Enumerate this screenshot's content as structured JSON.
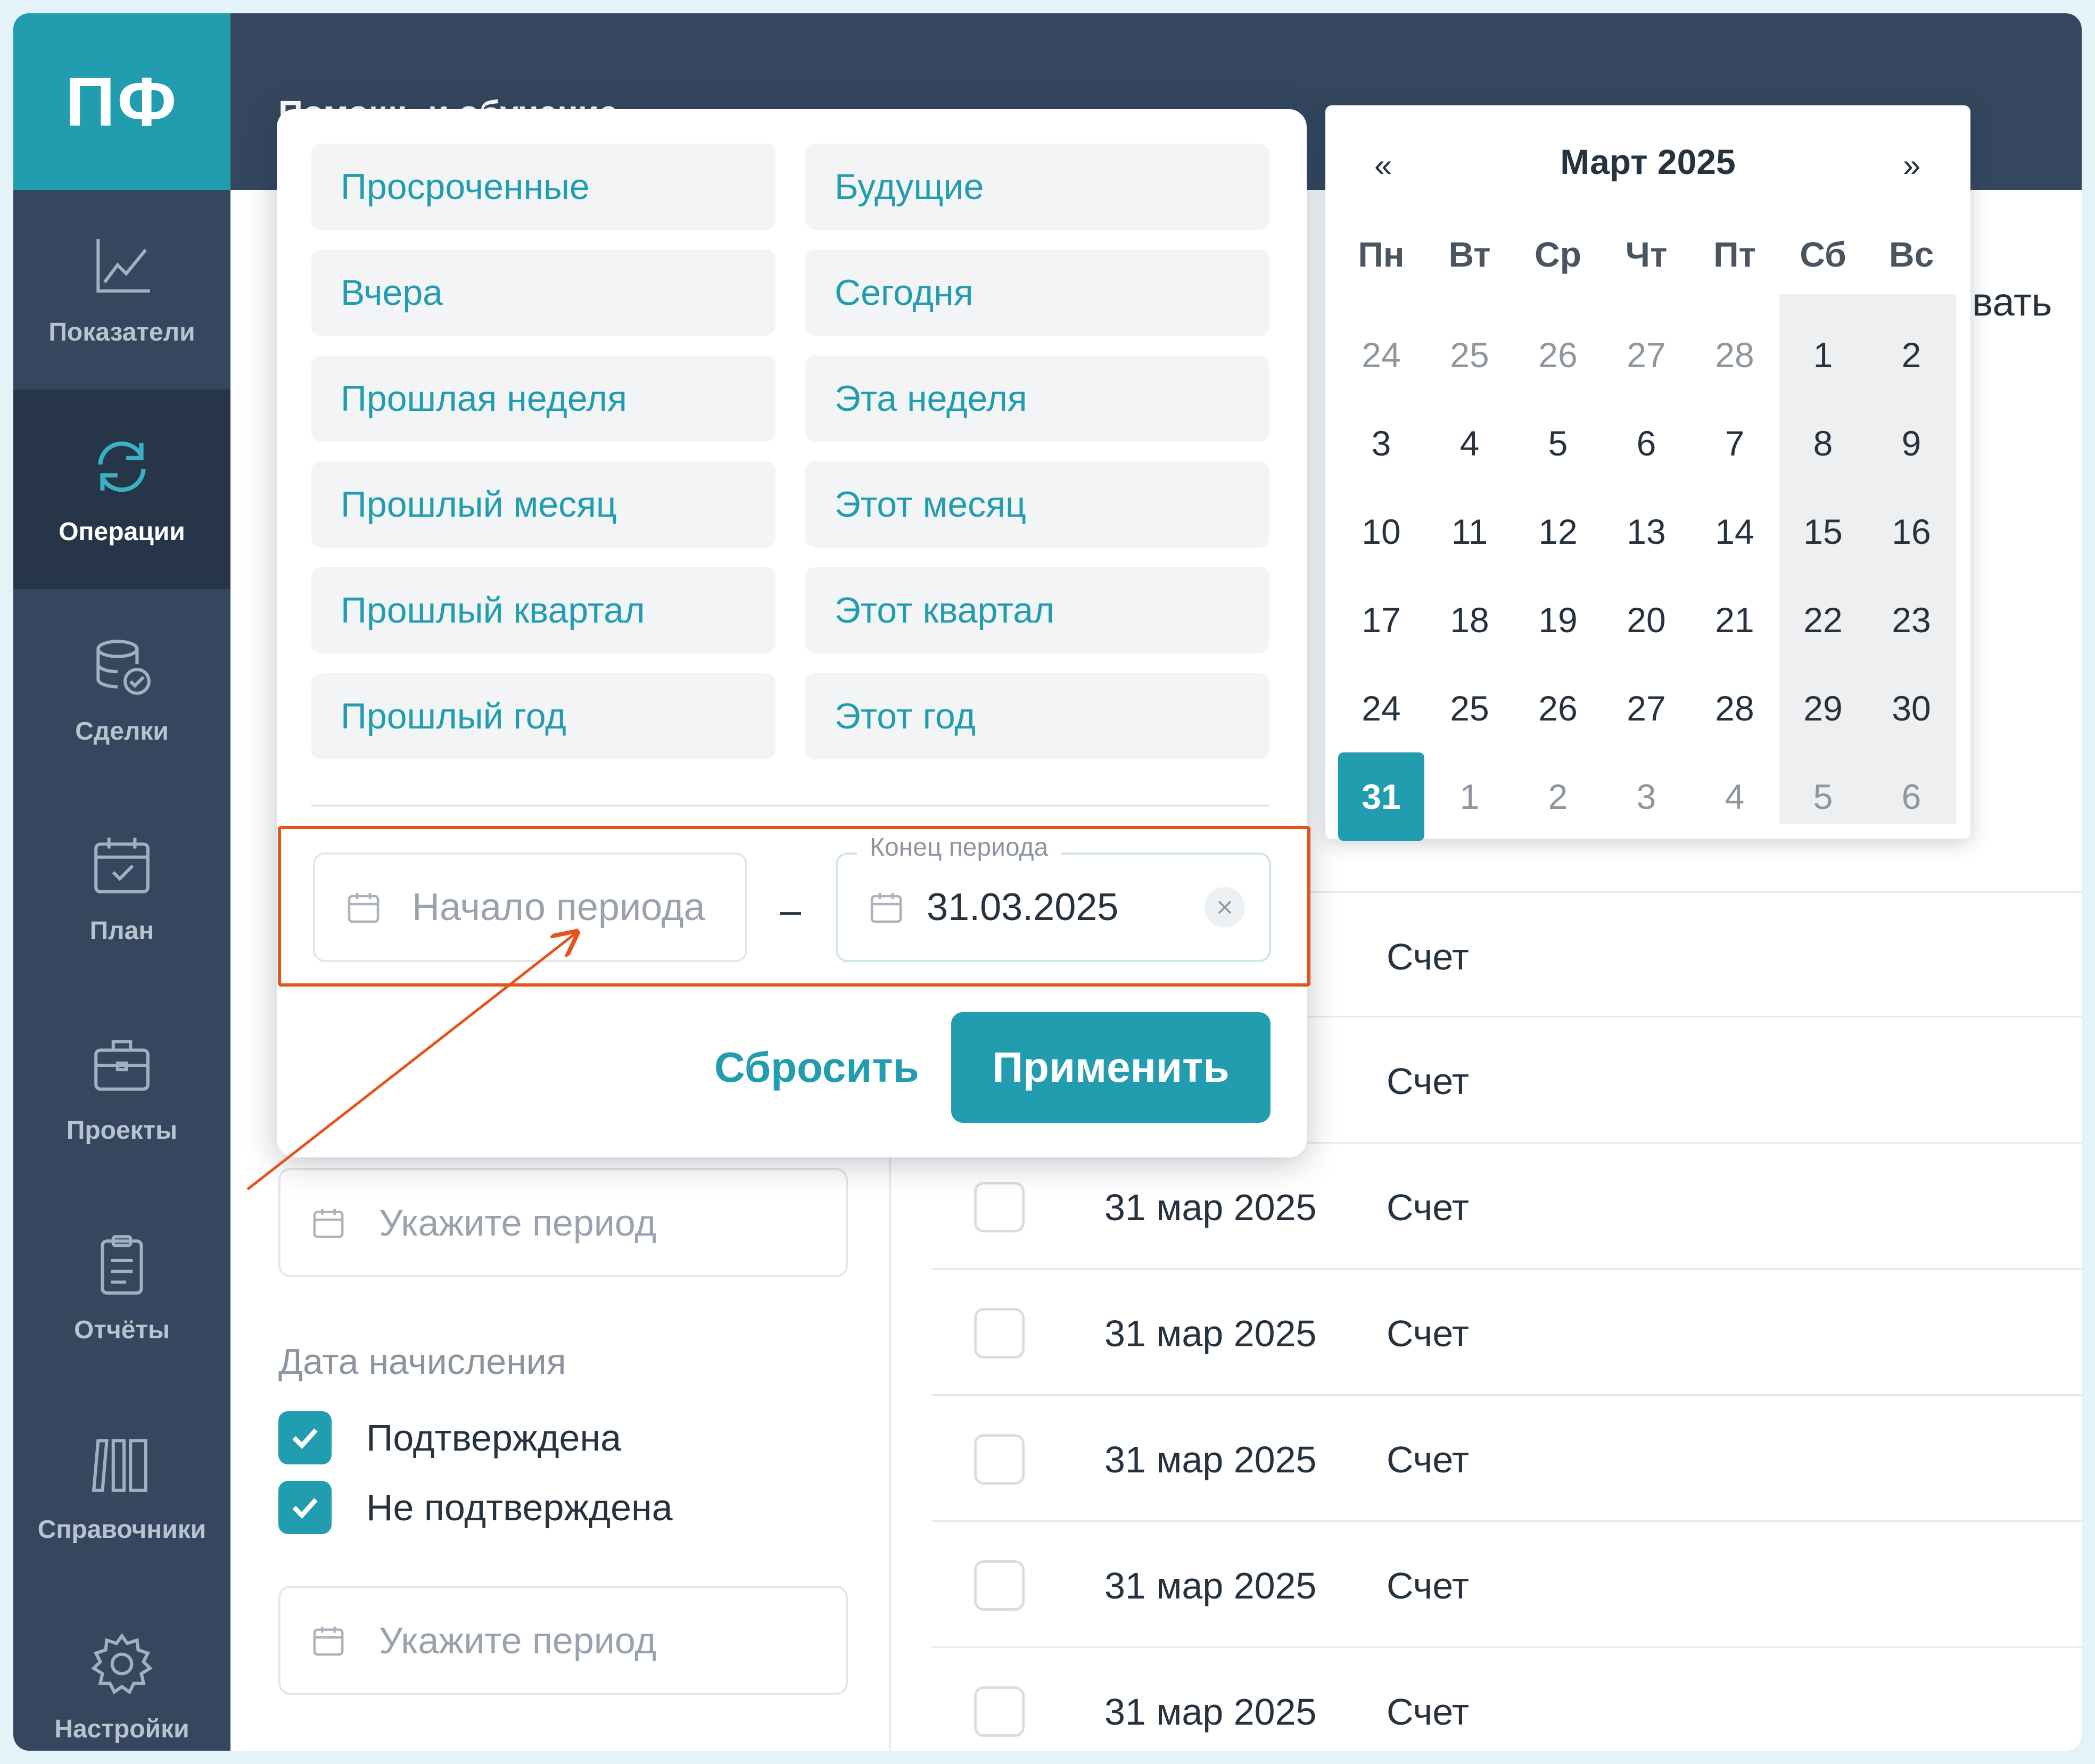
{
  "app": {
    "logo": "ПФ",
    "help_menu": "Помощь и обучение ⌄"
  },
  "sidebar": {
    "items": [
      {
        "label": "Показатели",
        "icon": "chart-line-icon"
      },
      {
        "label": "Операции",
        "icon": "refresh-cycle-icon",
        "active": true
      },
      {
        "label": "Сделки",
        "icon": "database-check-icon"
      },
      {
        "label": "План",
        "icon": "calendar-check-icon"
      },
      {
        "label": "Проекты",
        "icon": "briefcase-icon"
      },
      {
        "label": "Отчёты",
        "icon": "clipboard-icon"
      },
      {
        "label": "Справочники",
        "icon": "books-icon"
      },
      {
        "label": "Настройки",
        "icon": "gear-icon"
      }
    ]
  },
  "filters": {
    "period_placeholder": "Укажите период",
    "accrual_title": "Дата начисления",
    "checkbox_confirmed": "Подтверждена",
    "checkbox_unconfirmed": "Не подтверждена",
    "period_placeholder_2": "Укажите период"
  },
  "presets": [
    "Просроченные",
    "Будущие",
    "Вчера",
    "Сегодня",
    "Прошлая неделя",
    "Эта неделя",
    "Прошлый месяц",
    "Этот месяц",
    "Прошлый квартал",
    "Этот квартал",
    "Прошлый год",
    "Этот год"
  ],
  "range": {
    "start_placeholder": "Начало периода",
    "separator": "–",
    "end_label": "Конец периода",
    "end_value": "31.03.2025"
  },
  "buttons": {
    "reset": "Сбросить",
    "apply": "Применить"
  },
  "calendar": {
    "prev": "«",
    "next": "»",
    "title": "Март 2025",
    "weekdays": [
      "Пн",
      "Вт",
      "Ср",
      "Чт",
      "Пт",
      "Сб",
      "Вс"
    ],
    "days": [
      {
        "d": "24",
        "m": true
      },
      {
        "d": "25",
        "m": true
      },
      {
        "d": "26",
        "m": true
      },
      {
        "d": "27",
        "m": true
      },
      {
        "d": "28",
        "m": true
      },
      {
        "d": "1"
      },
      {
        "d": "2"
      },
      {
        "d": "3"
      },
      {
        "d": "4"
      },
      {
        "d": "5"
      },
      {
        "d": "6"
      },
      {
        "d": "7"
      },
      {
        "d": "8"
      },
      {
        "d": "9"
      },
      {
        "d": "10"
      },
      {
        "d": "11"
      },
      {
        "d": "12"
      },
      {
        "d": "13"
      },
      {
        "d": "14"
      },
      {
        "d": "15"
      },
      {
        "d": "16"
      },
      {
        "d": "17"
      },
      {
        "d": "18"
      },
      {
        "d": "19"
      },
      {
        "d": "20"
      },
      {
        "d": "21"
      },
      {
        "d": "22"
      },
      {
        "d": "23"
      },
      {
        "d": "24"
      },
      {
        "d": "25"
      },
      {
        "d": "26"
      },
      {
        "d": "27"
      },
      {
        "d": "28"
      },
      {
        "d": "29"
      },
      {
        "d": "30"
      },
      {
        "d": "31",
        "selected": true
      },
      {
        "d": "1",
        "m": true
      },
      {
        "d": "2",
        "m": true
      },
      {
        "d": "3",
        "m": true
      },
      {
        "d": "4",
        "m": true
      },
      {
        "d": "5",
        "m": true
      },
      {
        "d": "6",
        "m": true
      }
    ]
  },
  "table": {
    "header_partial": "вать",
    "rows": [
      {
        "date": "",
        "type": "Счет"
      },
      {
        "date": "",
        "type": "Счет"
      },
      {
        "date": "31 мар 2025",
        "type": "Счет"
      },
      {
        "date": "31 мар 2025",
        "type": "Счет"
      },
      {
        "date": "31 мар 2025",
        "type": "Счет"
      },
      {
        "date": "31 мар 2025",
        "type": "Счет"
      },
      {
        "date": "31 мар 2025",
        "type": "Счет"
      }
    ]
  },
  "colors": {
    "accent": "#229caf",
    "sidebar": "#34475e",
    "annotation": "#e5521a"
  }
}
